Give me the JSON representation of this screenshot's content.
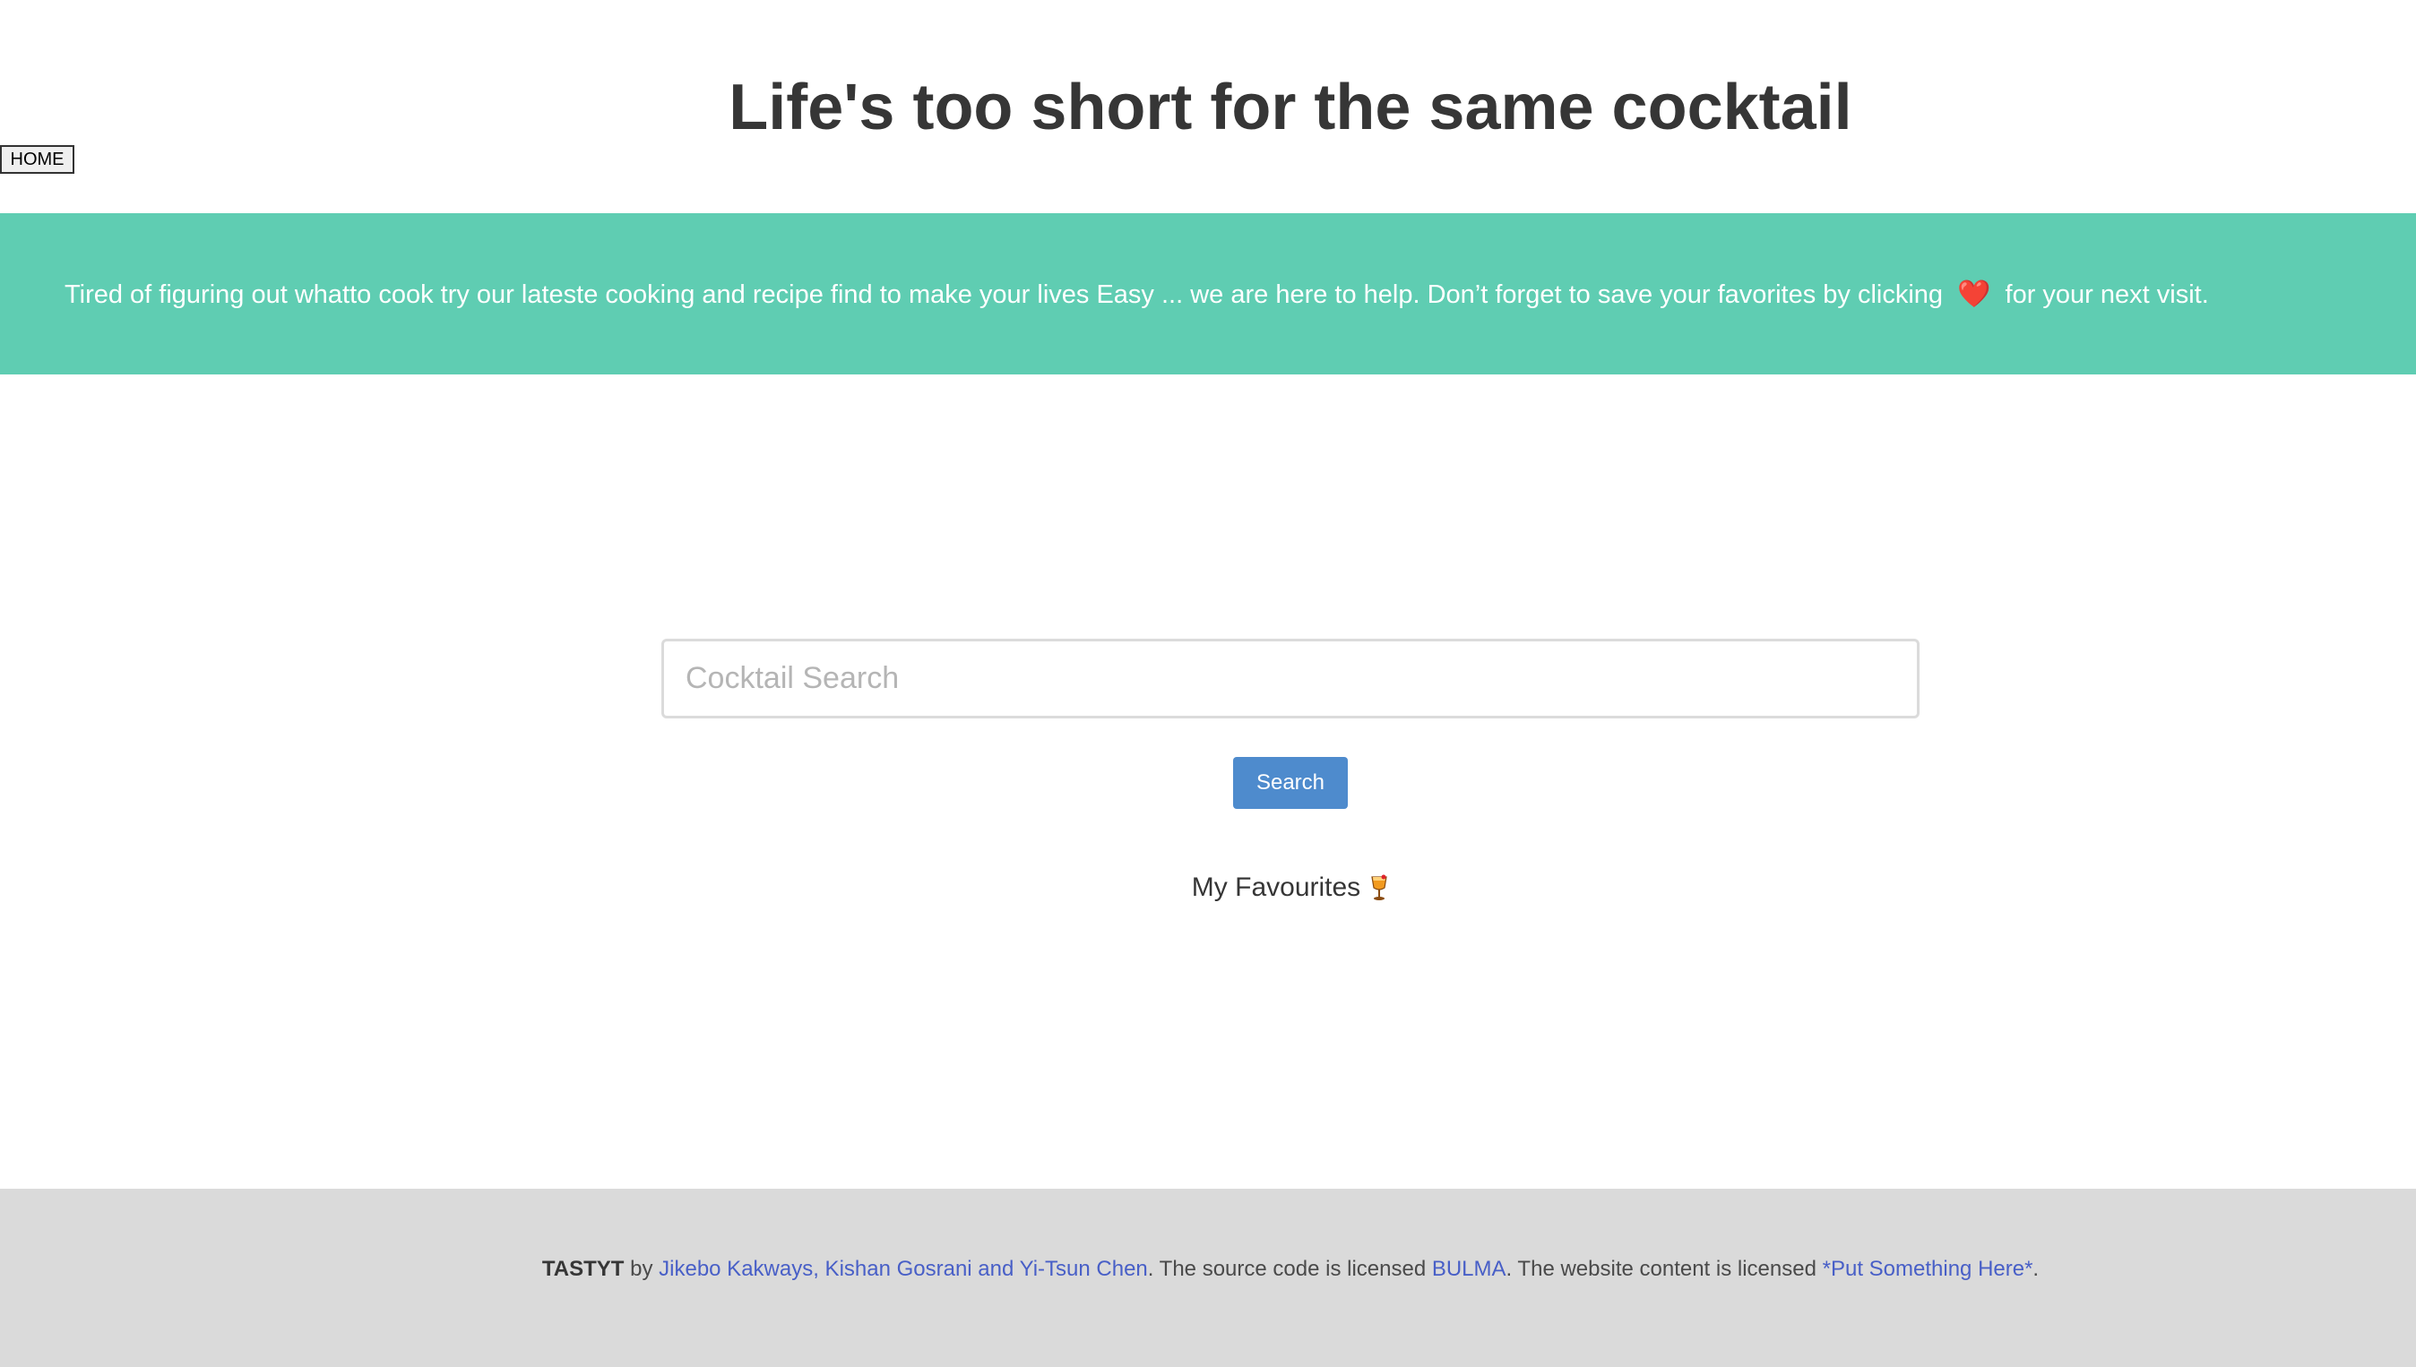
{
  "header": {
    "home_label": "HOME",
    "title": "Life's too short for the same cocktail"
  },
  "banner": {
    "text_before": "Tired of figuring out whatto cook try our lateste cooking and recipe find to make your lives Easy ... we are here to help. Don’t forget to save your favorites by clicking",
    "heart_glyph": "❤️",
    "text_after": "for your next visit.",
    "background": "#5fcdb2"
  },
  "search": {
    "placeholder": "Cocktail Search",
    "value": "",
    "button_label": "Search",
    "button_color": "#4e8bcd"
  },
  "favourites": {
    "label": "My Favourites",
    "icon": "cocktail-glass-icon"
  },
  "footer": {
    "brand": "TASTYT",
    "by": "by",
    "authors": "Jikebo Kakways, Kishan Gosrani and Yi-Tsun Chen",
    "source_text": ". The source code is licensed",
    "source_license": "BULMA",
    "content_text": ". The website content is licensed",
    "content_license": "*Put Something Here*",
    "end": ".",
    "background": "#dadada",
    "link_color": "#485fc7"
  }
}
